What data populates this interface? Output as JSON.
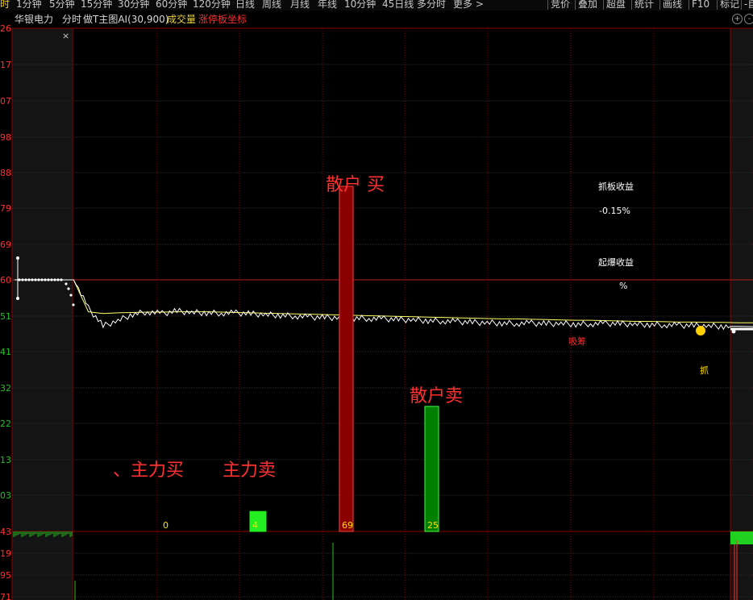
{
  "toolbar": {
    "items": [
      "时",
      "1分钟",
      "5分钟",
      "15分钟",
      "30分钟",
      "60分钟",
      "120分钟",
      "日线",
      "周线",
      "月线",
      "年线",
      "10分钟",
      "45日线",
      "多分时",
      "更多 >"
    ],
    "right_items": [
      "竞价",
      "叠加",
      "超盘",
      "统计",
      "画线",
      "F10",
      "标记",
      "-自"
    ]
  },
  "infobar": {
    "stock_name": "华银电力",
    "mode": "分时",
    "indicator": "做T主图AI(30,900)",
    "volume_label": "成交量",
    "limit_label": "涨停板坐标",
    "plus_icon": "+",
    "minus_icon": "-"
  },
  "close_icon": "×",
  "colors": {
    "up": "#ff3030",
    "down": "#20c020",
    "grid": "#8b0000",
    "price": "#ffffff",
    "avg": "#ffff66",
    "bar_red": "#8b0000",
    "bar_green": "#008000",
    "bar_lime": "#22ee22"
  },
  "y_axis": {
    "labels": [
      "26",
      "17",
      "07",
      "98",
      "88",
      "79",
      "69",
      "60",
      "51",
      "41",
      "32",
      "22",
      "13",
      "03",
      "43",
      "19",
      "95",
      "71"
    ],
    "colors": [
      "up",
      "up",
      "up",
      "up",
      "up",
      "up",
      "up",
      "up",
      "down",
      "down",
      "down",
      "down",
      "down",
      "down",
      "up",
      "up",
      "up",
      "up"
    ]
  },
  "annotations": {
    "retail_buy": "散户 买",
    "retail_sell": "散户卖",
    "main_buy": "、主力买",
    "main_sell": "主力卖",
    "grab_board_return": "抓板收益",
    "grab_board_value": "-0.15%",
    "explode_return": "起爆收益",
    "explode_value": "%",
    "chip_label": "吸筹",
    "grab_label": "抓"
  },
  "chart_data": {
    "type": "line",
    "price_series": [
      0,
      0,
      0,
      0,
      0,
      -0.8,
      -1.3,
      -1.15,
      -0.97,
      -0.9,
      -0.95,
      -0.88,
      -0.92,
      -0.93,
      -0.94,
      -0.93,
      -0.96,
      -0.98,
      -1.0,
      -1.02,
      -1.05,
      -1.06,
      -1.07,
      -1.08,
      -1.09,
      -1.1,
      -1.12,
      -1.13,
      -1.15,
      -1.16,
      -1.18,
      -1.2,
      -1.21,
      -1.22,
      -1.23,
      -1.22,
      -1.24,
      -1.23,
      -1.25,
      -1.24,
      -1.23,
      -1.24,
      -1.25,
      -1.26,
      -1.27,
      -1.28,
      -1.29,
      -1.3,
      -1.31,
      -1.31,
      -1.32
    ],
    "avg_series": [
      0,
      0,
      0,
      0,
      0,
      -0.9,
      -0.95,
      -0.93,
      -0.92,
      -0.91,
      -0.91,
      -0.9,
      -0.9,
      -0.9,
      -0.91,
      -0.92,
      -0.93,
      -0.94,
      -0.95,
      -0.96,
      -0.97,
      -0.98,
      -0.99,
      -1.0,
      -1.01,
      -1.02,
      -1.03,
      -1.04,
      -1.05,
      -1.06,
      -1.07,
      -1.08,
      -1.09,
      -1.1,
      -1.1,
      -1.11,
      -1.12,
      -1.13,
      -1.14,
      -1.14,
      -1.15,
      -1.16,
      -1.17,
      -1.17,
      -1.18,
      -1.19,
      -1.19,
      -1.2,
      -1.2,
      -1.21,
      -1.21
    ],
    "bars": [
      {
        "label": "0",
        "value": 0,
        "color": "bar_lime"
      },
      {
        "label": "4",
        "value": 4,
        "color": "bar_lime"
      },
      {
        "label": "69",
        "value": 69,
        "color": "bar_red"
      },
      {
        "label": "25",
        "value": 25,
        "color": "bar_green"
      }
    ]
  }
}
